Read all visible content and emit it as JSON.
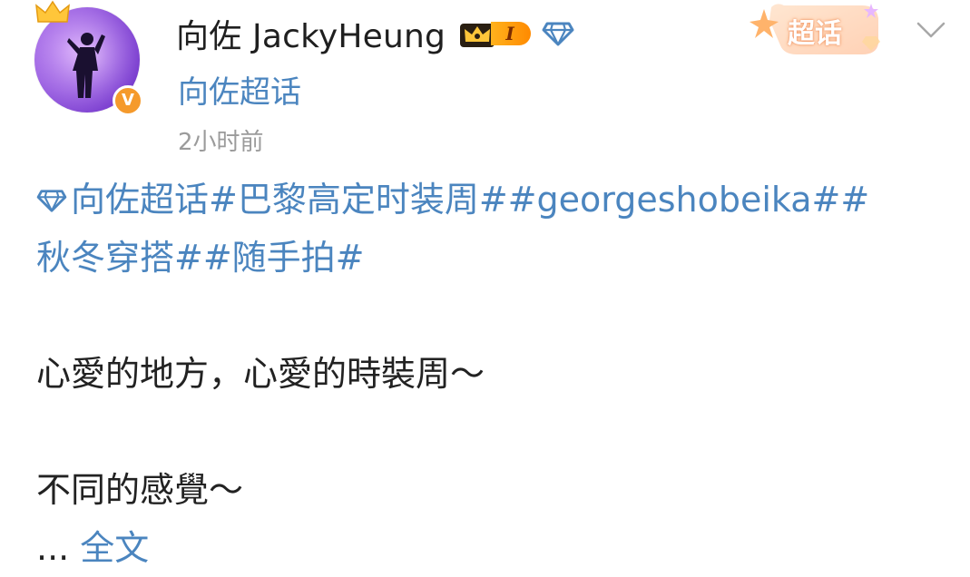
{
  "post": {
    "username": "向佐 JackyHeung",
    "vip_level": "I",
    "supertopic_name": "向佐超话",
    "timestamp": "2小时前",
    "supertopic_sticker": "超话",
    "topic_line_1": "向佐超话#巴黎高定时装周##georgeshobeika##",
    "topic_line_2": "秋冬穿搭##随手拍#",
    "content_line_1": "心愛的地方，心愛的時裝周～",
    "content_line_2": "不同的感覺～",
    "ellipsis": "...",
    "full_text_link": "全文"
  },
  "icons": {
    "verified": "verified-badge-icon",
    "vip_crown": "crown-icon",
    "diamond": "diamond-icon",
    "dropdown": "chevron-down-icon"
  },
  "colors": {
    "link": "#4b85bf",
    "text": "#222222",
    "timestamp": "#9b9b9b",
    "verified": "#f59a2c",
    "vip": "#ff9a12"
  }
}
